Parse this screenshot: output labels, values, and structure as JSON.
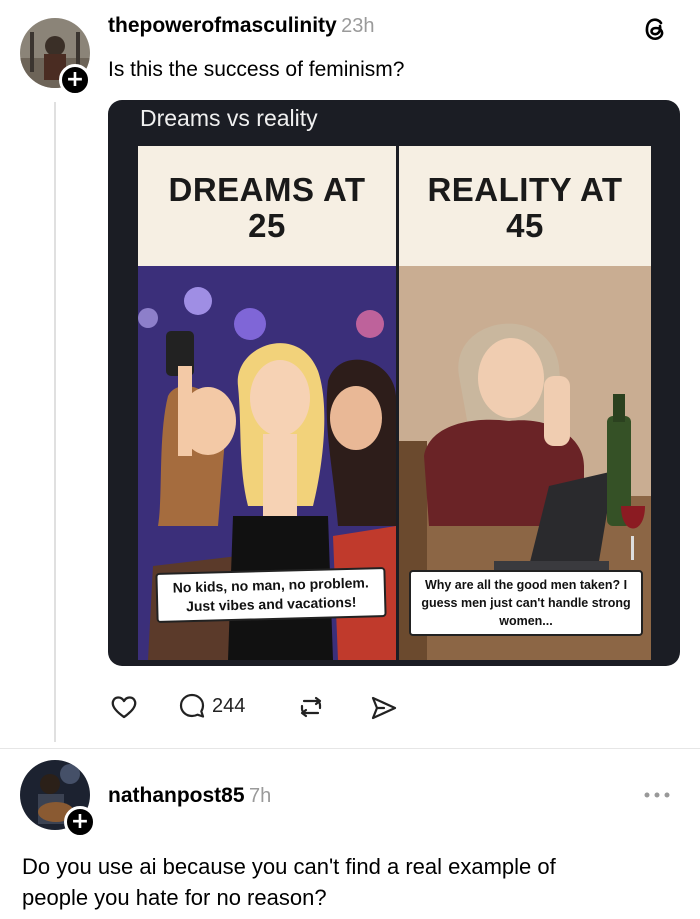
{
  "post": {
    "username": "thepowerofmasculinity",
    "time": "23h",
    "text": "Is this the success of feminism?",
    "image": {
      "title": "Dreams vs reality",
      "left_heading_line1": "DREAMS AT",
      "left_heading_line2": "25",
      "right_heading_line1": "REALITY AT",
      "right_heading_line2": "45",
      "left_caption_line1": "No kids, no man, no problem.",
      "left_caption_line2": "Just vibes and vacations!",
      "right_caption_line1": "Why are all the good men taken? I",
      "right_caption_line2": "guess men just can't handle strong",
      "right_caption_line3": "women..."
    },
    "actions": {
      "reply_count": "244"
    }
  },
  "reply": {
    "username": "nathanpost85",
    "time": "7h",
    "text_line1": "Do you use ai because you can't find a real example of",
    "text_line2": "people you hate for no reason?"
  },
  "colors": {
    "dark_bg": "#1b1d24",
    "panel_cream": "#f6efe3",
    "party_purple": "#3b2f7a",
    "wall_tan": "#c9ad92"
  },
  "icons": [
    "threads-logo-icon",
    "plus-icon",
    "heart-icon",
    "comment-icon",
    "repost-icon",
    "share-icon",
    "more-icon"
  ]
}
